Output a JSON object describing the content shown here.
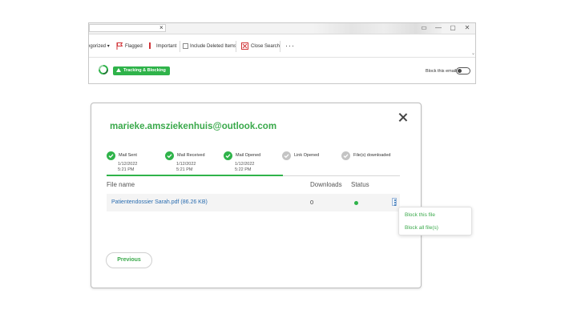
{
  "outlook": {
    "ribbon": {
      "categorized_label": "egorized",
      "categorized_caret": "▾",
      "flagged_label": "Flagged",
      "important_label": "Important",
      "include_deleted_label": "Include Deleted Items",
      "close_search_label": "Close Search",
      "more_label": "···"
    },
    "search_clear": "×",
    "window_buttons": [
      "▭",
      "—",
      "▢",
      "✕"
    ],
    "scroll_caret": "⌄",
    "addin": {
      "badge_label": "Tracking & Blocking",
      "block_email_label": "Block this email",
      "block_email_on": false
    }
  },
  "dialog": {
    "close_symbol": "",
    "email": "marieke.amsziekenhuis@outlook.com",
    "steps": [
      {
        "label": "Mail Sent",
        "date": "1/12/2022",
        "time": "5:21 PM",
        "done": true
      },
      {
        "label": "Mail Received",
        "date": "1/12/2022",
        "time": "5:21 PM",
        "done": true
      },
      {
        "label": "Mail Opened",
        "date": "1/12/2022",
        "time": "5:22 PM",
        "done": true
      },
      {
        "label": "Link Opened",
        "date": "",
        "time": "",
        "done": false
      },
      {
        "label": "File(s) downloaded",
        "date": "",
        "time": "",
        "done": false
      }
    ],
    "progress_fraction": 0.6,
    "table": {
      "headers": {
        "file_name": "File name",
        "downloads": "Downloads",
        "status": "Status"
      },
      "rows": [
        {
          "file_name": "Patientendossier Sarah.pdf (86.26 KB)",
          "downloads": "0",
          "status_color": "#2fb34a"
        }
      ]
    },
    "previous_label": "Previous"
  },
  "context_menu": {
    "items": [
      "Block this file",
      "Block all file(s)"
    ]
  },
  "colors": {
    "accent_green": "#2fb34a",
    "link_blue": "#2a6db0",
    "danger_red": "#d13438"
  }
}
